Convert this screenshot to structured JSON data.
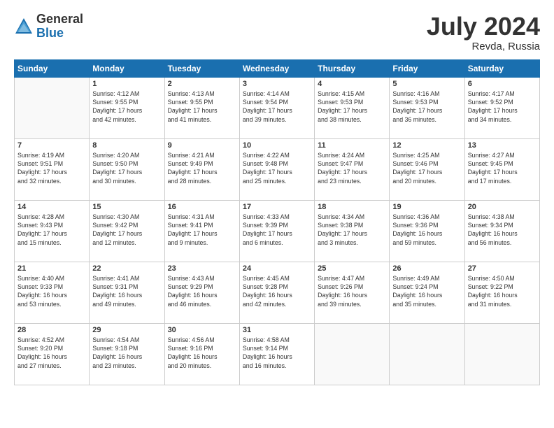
{
  "logo": {
    "general": "General",
    "blue": "Blue"
  },
  "header": {
    "month_year": "July 2024",
    "location": "Revda, Russia"
  },
  "days_of_week": [
    "Sunday",
    "Monday",
    "Tuesday",
    "Wednesday",
    "Thursday",
    "Friday",
    "Saturday"
  ],
  "weeks": [
    [
      {
        "day": "",
        "info": ""
      },
      {
        "day": "1",
        "info": "Sunrise: 4:12 AM\nSunset: 9:55 PM\nDaylight: 17 hours\nand 42 minutes."
      },
      {
        "day": "2",
        "info": "Sunrise: 4:13 AM\nSunset: 9:55 PM\nDaylight: 17 hours\nand 41 minutes."
      },
      {
        "day": "3",
        "info": "Sunrise: 4:14 AM\nSunset: 9:54 PM\nDaylight: 17 hours\nand 39 minutes."
      },
      {
        "day": "4",
        "info": "Sunrise: 4:15 AM\nSunset: 9:53 PM\nDaylight: 17 hours\nand 38 minutes."
      },
      {
        "day": "5",
        "info": "Sunrise: 4:16 AM\nSunset: 9:53 PM\nDaylight: 17 hours\nand 36 minutes."
      },
      {
        "day": "6",
        "info": "Sunrise: 4:17 AM\nSunset: 9:52 PM\nDaylight: 17 hours\nand 34 minutes."
      }
    ],
    [
      {
        "day": "7",
        "info": "Sunrise: 4:19 AM\nSunset: 9:51 PM\nDaylight: 17 hours\nand 32 minutes."
      },
      {
        "day": "8",
        "info": "Sunrise: 4:20 AM\nSunset: 9:50 PM\nDaylight: 17 hours\nand 30 minutes."
      },
      {
        "day": "9",
        "info": "Sunrise: 4:21 AM\nSunset: 9:49 PM\nDaylight: 17 hours\nand 28 minutes."
      },
      {
        "day": "10",
        "info": "Sunrise: 4:22 AM\nSunset: 9:48 PM\nDaylight: 17 hours\nand 25 minutes."
      },
      {
        "day": "11",
        "info": "Sunrise: 4:24 AM\nSunset: 9:47 PM\nDaylight: 17 hours\nand 23 minutes."
      },
      {
        "day": "12",
        "info": "Sunrise: 4:25 AM\nSunset: 9:46 PM\nDaylight: 17 hours\nand 20 minutes."
      },
      {
        "day": "13",
        "info": "Sunrise: 4:27 AM\nSunset: 9:45 PM\nDaylight: 17 hours\nand 17 minutes."
      }
    ],
    [
      {
        "day": "14",
        "info": "Sunrise: 4:28 AM\nSunset: 9:43 PM\nDaylight: 17 hours\nand 15 minutes."
      },
      {
        "day": "15",
        "info": "Sunrise: 4:30 AM\nSunset: 9:42 PM\nDaylight: 17 hours\nand 12 minutes."
      },
      {
        "day": "16",
        "info": "Sunrise: 4:31 AM\nSunset: 9:41 PM\nDaylight: 17 hours\nand 9 minutes."
      },
      {
        "day": "17",
        "info": "Sunrise: 4:33 AM\nSunset: 9:39 PM\nDaylight: 17 hours\nand 6 minutes."
      },
      {
        "day": "18",
        "info": "Sunrise: 4:34 AM\nSunset: 9:38 PM\nDaylight: 17 hours\nand 3 minutes."
      },
      {
        "day": "19",
        "info": "Sunrise: 4:36 AM\nSunset: 9:36 PM\nDaylight: 16 hours\nand 59 minutes."
      },
      {
        "day": "20",
        "info": "Sunrise: 4:38 AM\nSunset: 9:34 PM\nDaylight: 16 hours\nand 56 minutes."
      }
    ],
    [
      {
        "day": "21",
        "info": "Sunrise: 4:40 AM\nSunset: 9:33 PM\nDaylight: 16 hours\nand 53 minutes."
      },
      {
        "day": "22",
        "info": "Sunrise: 4:41 AM\nSunset: 9:31 PM\nDaylight: 16 hours\nand 49 minutes."
      },
      {
        "day": "23",
        "info": "Sunrise: 4:43 AM\nSunset: 9:29 PM\nDaylight: 16 hours\nand 46 minutes."
      },
      {
        "day": "24",
        "info": "Sunrise: 4:45 AM\nSunset: 9:28 PM\nDaylight: 16 hours\nand 42 minutes."
      },
      {
        "day": "25",
        "info": "Sunrise: 4:47 AM\nSunset: 9:26 PM\nDaylight: 16 hours\nand 39 minutes."
      },
      {
        "day": "26",
        "info": "Sunrise: 4:49 AM\nSunset: 9:24 PM\nDaylight: 16 hours\nand 35 minutes."
      },
      {
        "day": "27",
        "info": "Sunrise: 4:50 AM\nSunset: 9:22 PM\nDaylight: 16 hours\nand 31 minutes."
      }
    ],
    [
      {
        "day": "28",
        "info": "Sunrise: 4:52 AM\nSunset: 9:20 PM\nDaylight: 16 hours\nand 27 minutes."
      },
      {
        "day": "29",
        "info": "Sunrise: 4:54 AM\nSunset: 9:18 PM\nDaylight: 16 hours\nand 23 minutes."
      },
      {
        "day": "30",
        "info": "Sunrise: 4:56 AM\nSunset: 9:16 PM\nDaylight: 16 hours\nand 20 minutes."
      },
      {
        "day": "31",
        "info": "Sunrise: 4:58 AM\nSunset: 9:14 PM\nDaylight: 16 hours\nand 16 minutes."
      },
      {
        "day": "",
        "info": ""
      },
      {
        "day": "",
        "info": ""
      },
      {
        "day": "",
        "info": ""
      }
    ]
  ]
}
